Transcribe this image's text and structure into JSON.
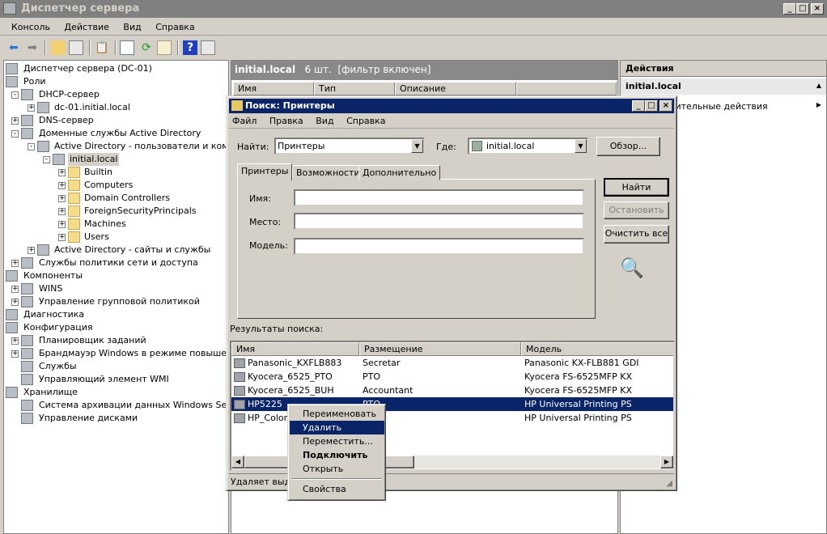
{
  "window": {
    "title": "Диспетчер сервера",
    "min": "_",
    "max": "□",
    "close": "×"
  },
  "menu": [
    "Консоль",
    "Действие",
    "Вид",
    "Справка"
  ],
  "toolbar_icons": [
    "back-arrow-icon",
    "forward-arrow-icon",
    "up-folder-icon",
    "show-hide-tree-icon",
    "clipboard-icon",
    "properties-icon",
    "refresh-icon",
    "export-list-icon",
    "help-icon",
    "show-hide-action-pane-icon"
  ],
  "tree": [
    {
      "label": "Диспетчер сервера (DC-01)",
      "level": 0,
      "exp": ""
    },
    {
      "label": "Роли",
      "level": 0,
      "exp": "-"
    },
    {
      "label": "DHCP-сервер",
      "level": 1,
      "exp": "-"
    },
    {
      "label": "dc-01.initial.local",
      "level": 2,
      "exp": "+"
    },
    {
      "label": "DNS-сервер",
      "level": 1,
      "exp": "+"
    },
    {
      "label": "Доменные службы Active Directory",
      "level": 1,
      "exp": "-"
    },
    {
      "label": "Active Directory - пользователи и компьютеры",
      "level": 2,
      "exp": "-"
    },
    {
      "label": "initial.local",
      "level": 3,
      "exp": "-",
      "selected": true
    },
    {
      "label": "Builtin",
      "level": 4,
      "exp": "+",
      "folder": true
    },
    {
      "label": "Computers",
      "level": 4,
      "exp": "+",
      "folder": true
    },
    {
      "label": "Domain Controllers",
      "level": 4,
      "exp": "+",
      "folder": true
    },
    {
      "label": "ForeignSecurityPrincipals",
      "level": 4,
      "exp": "+",
      "folder": true
    },
    {
      "label": "Machines",
      "level": 4,
      "exp": "+",
      "folder": true
    },
    {
      "label": "Users",
      "level": 4,
      "exp": "+",
      "folder": true
    },
    {
      "label": "Active Directory - сайты и службы",
      "level": 2,
      "exp": "+"
    },
    {
      "label": "Службы политики сети и доступа",
      "level": 1,
      "exp": "+"
    },
    {
      "label": "Компоненты",
      "level": 0,
      "exp": "-"
    },
    {
      "label": "WINS",
      "level": 1,
      "exp": "+"
    },
    {
      "label": "Управление групповой политикой",
      "level": 1,
      "exp": "+"
    },
    {
      "label": "Диагностика",
      "level": 0,
      "exp": "+"
    },
    {
      "label": "Конфигурация",
      "level": 0,
      "exp": "-"
    },
    {
      "label": "Планировщик заданий",
      "level": 1,
      "exp": "+"
    },
    {
      "label": "Брандмауэр Windows в режиме повышенной безопасности",
      "level": 1,
      "exp": "+"
    },
    {
      "label": "Службы",
      "level": 1,
      "exp": ""
    },
    {
      "label": "Управляющий элемент WMI",
      "level": 1,
      "exp": ""
    },
    {
      "label": "Хранилище",
      "level": 0,
      "exp": "-"
    },
    {
      "label": "Система архивации данных Windows Server",
      "level": 1,
      "exp": ""
    },
    {
      "label": "Управление дисками",
      "level": 1,
      "exp": ""
    }
  ],
  "middle": {
    "title": "initial.local",
    "count": "6 шт.",
    "filter": "[фильтр включен]",
    "columns": [
      "Имя",
      "Тип",
      "Описание"
    ]
  },
  "actions": {
    "header": "Действия",
    "section": "initial.local",
    "more": "Дополнительные действия"
  },
  "dialog": {
    "title": "Поиск: Принтеры",
    "menu": [
      "Файл",
      "Правка",
      "Вид",
      "Справка"
    ],
    "find_label": "Найти:",
    "find_value": "Принтеры",
    "where_label": "Где:",
    "where_value": "initial.local",
    "browse": "Обзор...",
    "tabs": [
      "Принтеры",
      "Возможности",
      "Дополнительно"
    ],
    "fields": [
      {
        "label": "Имя:",
        "value": ""
      },
      {
        "label": "Место:",
        "value": ""
      },
      {
        "label": "Модель:",
        "value": ""
      }
    ],
    "buttons": {
      "find": "Найти",
      "stop": "Остановить",
      "clear": "Очистить все"
    },
    "results_label": "Результаты поиска:",
    "columns": [
      "Имя",
      "Размещение",
      "Модель"
    ],
    "rows": [
      {
        "name": "Panasonic_KXFLB883",
        "location": "Secretar",
        "model": "Panasonic KX-FLB881 GDI"
      },
      {
        "name": "Kyocera_6525_PTO",
        "location": "PTO",
        "model": "Kyocera FS-6525MFP KX"
      },
      {
        "name": "Kyocera_6525_BUH",
        "location": "Accountant",
        "model": "Kyocera FS-6525MFP KX"
      },
      {
        "name": "HP5225",
        "location": "PTO",
        "model": "HP Universal Printing PS",
        "selected": true
      },
      {
        "name": "HP_Color_",
        "location": "",
        "model": "HP Universal Printing PS"
      }
    ],
    "status": "Удаляет выде"
  },
  "context_menu": [
    {
      "label": "Переименовать"
    },
    {
      "label": "Удалить",
      "highlighted": true
    },
    {
      "label": "Переместить..."
    },
    {
      "label": "Подключить",
      "bold": true
    },
    {
      "label": "Открыть"
    },
    {
      "separator": true
    },
    {
      "label": "Свойства"
    }
  ],
  "colors": {
    "active_title": "#0a246a",
    "inactive_title": "#808080",
    "selection": "#0a246a",
    "face": "#d4d0c8"
  }
}
